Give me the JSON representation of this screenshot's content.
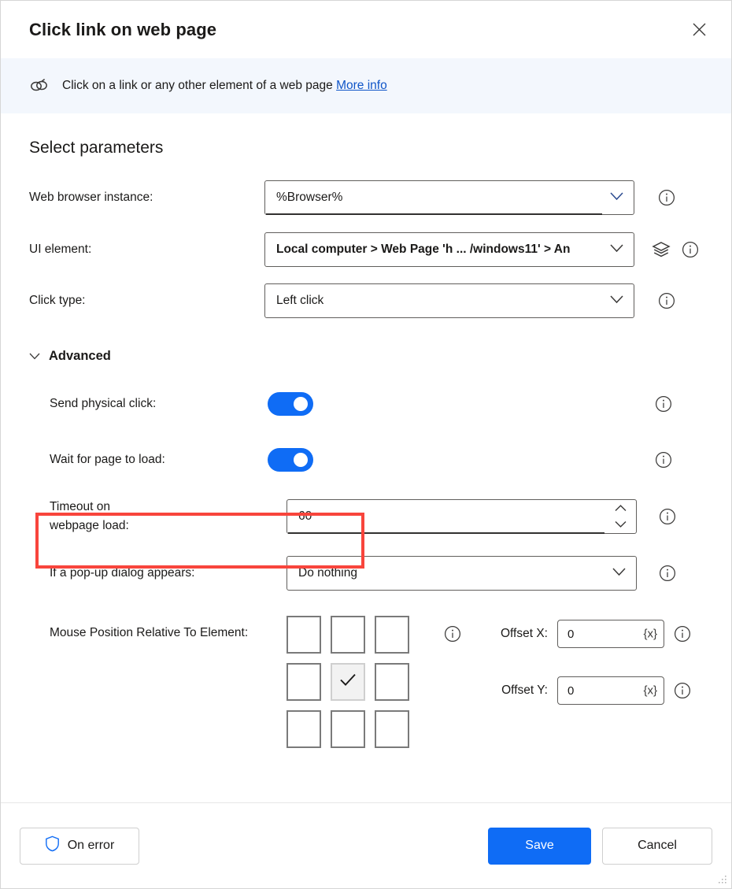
{
  "window": {
    "title": "Click link on web page",
    "close_icon": "close-icon"
  },
  "infobar": {
    "icon": "link-icon",
    "text": "Click on a link or any other element of a web page",
    "link_label": "More info"
  },
  "main": {
    "section_title": "Select parameters",
    "fields": [
      {
        "label": "Web browser instance:",
        "value": "%Browser%",
        "type": "combobox"
      },
      {
        "label": "UI element:",
        "value": "Local computer > Web Page 'h ... /windows11' > An",
        "type": "combobox"
      },
      {
        "label": "Click type:",
        "value": "Left click",
        "type": "combobox"
      }
    ],
    "advanced": {
      "label": "Advanced",
      "expanded": true,
      "send_physical_click": {
        "label": "Send physical click:",
        "value": "on"
      },
      "wait_for_page_to_load": {
        "label": "Wait for page to load:",
        "value": "on"
      },
      "timeout": {
        "label_line1": "Timeout on",
        "label_line2": "webpage load:",
        "value": "60"
      },
      "popup_dialog": {
        "label": "If a pop-up dialog appears:",
        "value": "Do nothing"
      },
      "mouse_position": {
        "label": "Mouse Position Relative To Element:",
        "cells": [
          {
            "name": "top-left",
            "selected": false
          },
          {
            "name": "top-center",
            "selected": false
          },
          {
            "name": "top-right",
            "selected": false
          },
          {
            "name": "middle-left",
            "selected": false
          },
          {
            "name": "middle-center",
            "selected": true
          },
          {
            "name": "middle-right",
            "selected": false
          },
          {
            "name": "bottom-left",
            "selected": false
          },
          {
            "name": "bottom-center",
            "selected": false
          },
          {
            "name": "bottom-right",
            "selected": false
          }
        ]
      },
      "offset_x": {
        "label": "Offset X:",
        "value": "0",
        "variable_token": "{x}"
      },
      "offset_y": {
        "label": "Offset Y:",
        "value": "0",
        "variable_token": "{x}"
      }
    }
  },
  "footer": {
    "on_error_label": "On error",
    "save_label": "Save",
    "cancel_label": "Cancel"
  },
  "colors": {
    "accent_blue": "#0f6cf5",
    "link_blue": "#0f55c8",
    "highlight_red": "#f8453c",
    "infobar_bg": "#f3f7fd",
    "border_gray": "#605e5c"
  }
}
